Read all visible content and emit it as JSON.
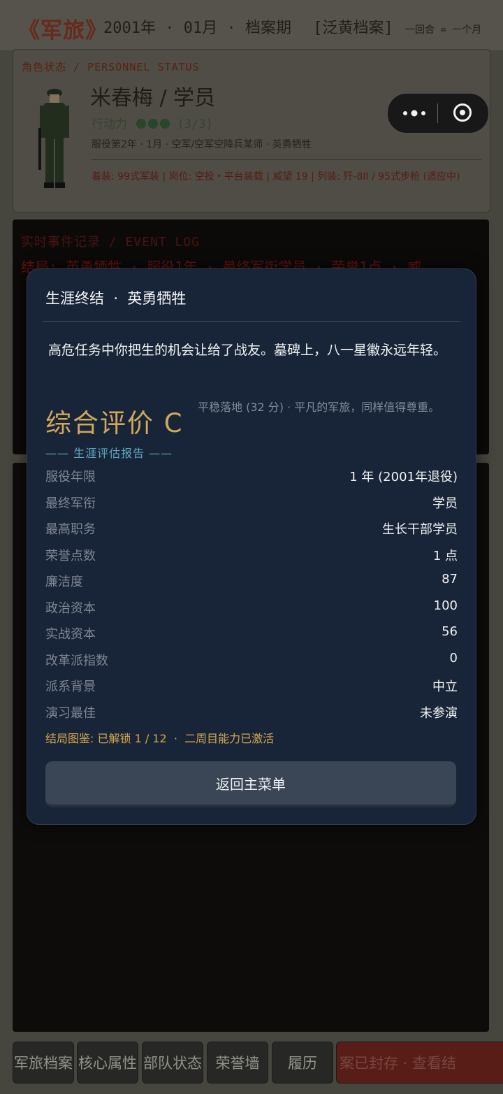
{
  "header": {
    "brand": "《军旅》",
    "date": "2001年 · 01月 · 档案期",
    "tag": "[泛黄档案]",
    "round_note": "一回合 = 一个月"
  },
  "status": {
    "heading": "角色状态 / PERSONNEL STATUS",
    "name": "米春梅  /  学员",
    "action_label": "行动力",
    "action_points": "(3/3)",
    "service": "服役第2年 · 1月 · 空军/空军空降兵某师 · 英勇牺牲",
    "equipment": "着装: 99式军装 | 岗位: 空投・平台装载 | 威望 19 | 列装: 歼-8II / 95式步枪 (适应中)"
  },
  "log": {
    "heading": "实时事件记录 / EVENT LOG",
    "line1": "结局: 英勇牺牲 · 服役1年 · 最终军衔学员 · 荣誉1点 · 威"
  },
  "modal": {
    "title": "生涯终结  ·  英勇牺牲",
    "text": "高危任务中你把生的机会让给了战友。墓碑上，八一星徽永远年轻。",
    "grade": "综合评价 C",
    "grade_desc": "平稳落地 (32 分) · 平凡的军旅，同样值得尊重。",
    "section": "—— 生涯评估报告 ——",
    "rows": [
      {
        "k": "服役年限",
        "v": "1 年 (2001年退役)"
      },
      {
        "k": "最终军衔",
        "v": "学员"
      },
      {
        "k": "最高职务",
        "v": "生长干部学员"
      },
      {
        "k": "荣誉点数",
        "v": "1 点"
      },
      {
        "k": "廉洁度",
        "v": "87"
      },
      {
        "k": "政治资本",
        "v": "100"
      },
      {
        "k": "实战资本",
        "v": "56"
      },
      {
        "k": "改革派指数",
        "v": "0"
      },
      {
        "k": "派系背景",
        "v": "中立"
      },
      {
        "k": "演习最佳",
        "v": "未参演"
      }
    ],
    "unlock": "结局图鉴: 已解锁 1 / 12  ·  二周目能力已激活",
    "button": "返回主菜单"
  },
  "tabs": [
    "军旅档案",
    "核心属性",
    "部队状态",
    "荣誉墙",
    "履历"
  ],
  "archive_bar": "案已封存  ·  查看结",
  "colors": {
    "modal_bg": "#182538",
    "grade": "#d1a75a",
    "accent": "#5fa7c0"
  }
}
